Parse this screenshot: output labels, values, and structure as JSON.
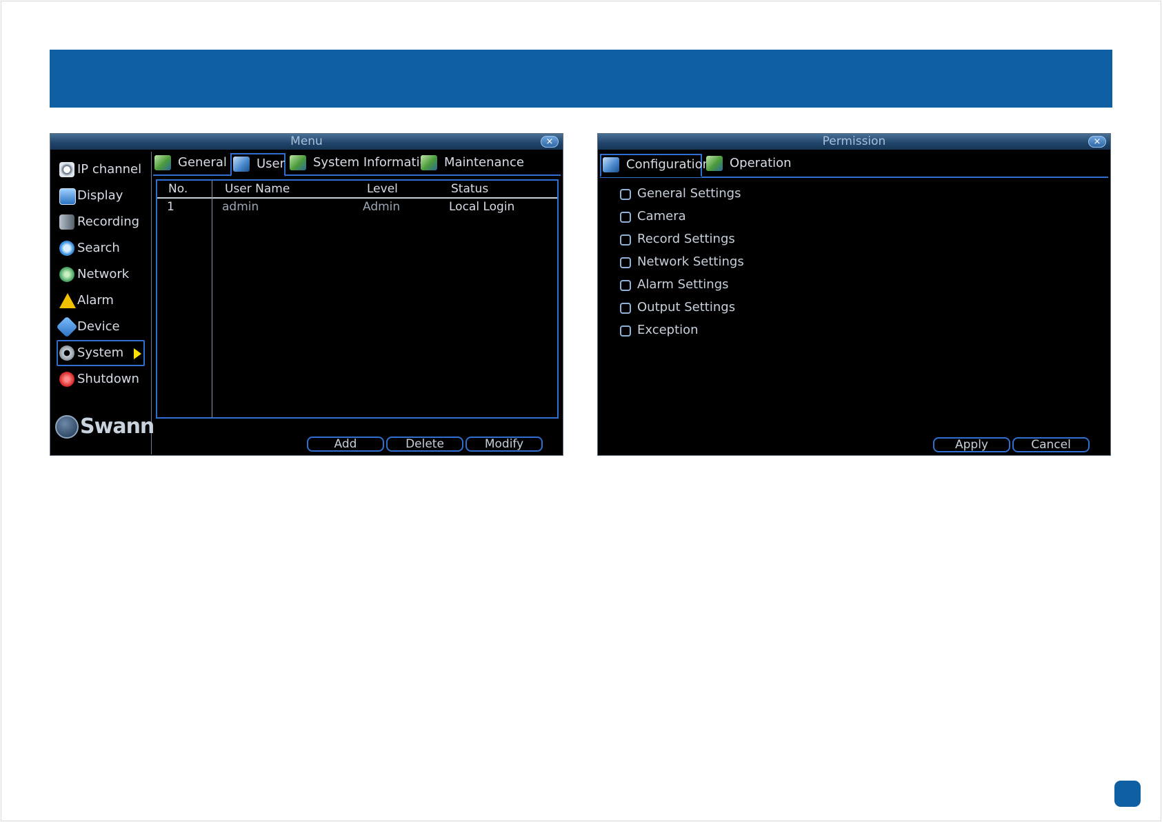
{
  "menu_window": {
    "title": "Menu",
    "close_label": "×",
    "sidebar": {
      "items": [
        {
          "label": "IP channel",
          "icon": "camera-icon"
        },
        {
          "label": "Display",
          "icon": "display-icon"
        },
        {
          "label": "Recording",
          "icon": "recording-icon"
        },
        {
          "label": "Search",
          "icon": "search-icon"
        },
        {
          "label": "Network",
          "icon": "network-icon"
        },
        {
          "label": "Alarm",
          "icon": "alarm-icon"
        },
        {
          "label": "Device",
          "icon": "device-icon"
        },
        {
          "label": "System",
          "icon": "gear-icon",
          "active": true
        },
        {
          "label": "Shutdown",
          "icon": "power-icon"
        }
      ],
      "logo": "Swann"
    },
    "tabs": [
      {
        "label": "General"
      },
      {
        "label": "User",
        "active": true
      },
      {
        "label": "System Information"
      },
      {
        "label": "Maintenance"
      }
    ],
    "user_table": {
      "columns": [
        "No.",
        "User Name",
        "Level",
        "Status"
      ],
      "rows": [
        {
          "no": "1",
          "user_name": "admin",
          "level": "Admin",
          "status": "Local Login"
        }
      ]
    },
    "buttons": {
      "add": "Add",
      "delete": "Delete",
      "modify": "Modify"
    }
  },
  "permission_window": {
    "title": "Permission",
    "close_label": "×",
    "tabs": [
      {
        "label": "Configuration",
        "active": true
      },
      {
        "label": "Operation"
      }
    ],
    "options": [
      {
        "label": "General Settings",
        "checked": false
      },
      {
        "label": "Camera",
        "checked": false
      },
      {
        "label": "Record Settings",
        "checked": false
      },
      {
        "label": "Network Settings",
        "checked": false
      },
      {
        "label": "Alarm Settings",
        "checked": false
      },
      {
        "label": "Output Settings",
        "checked": false
      },
      {
        "label": "Exception",
        "checked": false
      }
    ],
    "buttons": {
      "apply": "Apply",
      "cancel": "Cancel"
    }
  },
  "colors": {
    "banner": "#0f5fa3",
    "accent_border": "#2e6fd0",
    "selection_arrow": "#ffe000"
  }
}
